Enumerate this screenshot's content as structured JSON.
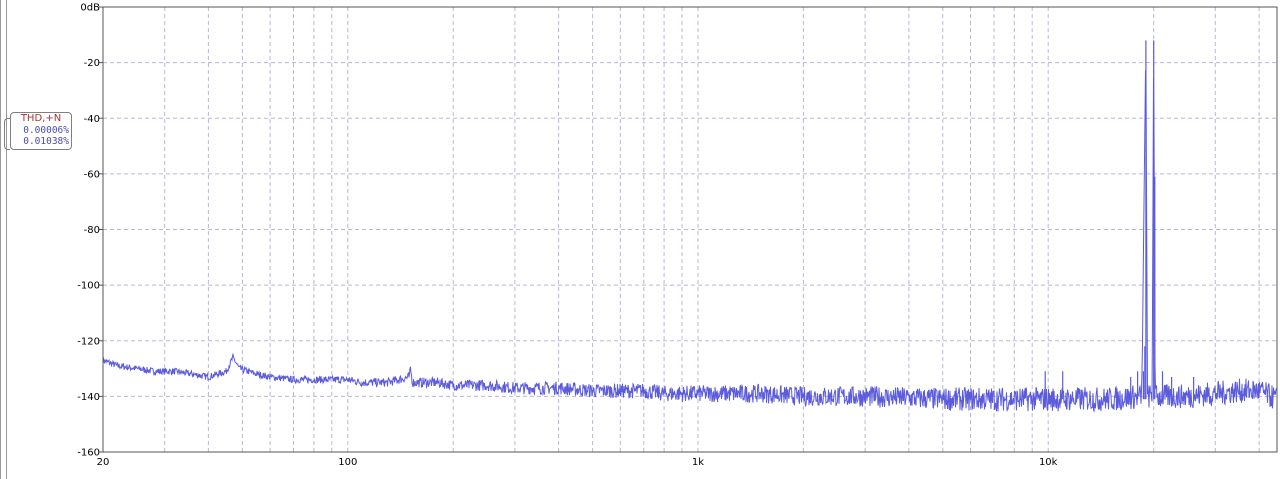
{
  "legend": {
    "title": "THD,+N",
    "values": [
      "0.00006%",
      "0.01038%"
    ]
  },
  "colors": {
    "trace": "#5b5bdc",
    "grid": "#b8b8d8",
    "frame": "#555555",
    "legend_title": "#b03030",
    "legend_value": "#4a4ab8"
  },
  "chart_data": {
    "type": "line",
    "title": "",
    "xlabel": "",
    "ylabel": "",
    "x_scale": "log",
    "xlim": [
      20,
      45000
    ],
    "ylim": [
      -160,
      0
    ],
    "grid": true,
    "x_ticks": [
      {
        "value": 20,
        "label": "20"
      },
      {
        "value": 100,
        "label": "100"
      },
      {
        "value": 1000,
        "label": "1k"
      },
      {
        "value": 10000,
        "label": "10k"
      }
    ],
    "y_ticks": [
      {
        "value": 0,
        "label": "0dB"
      },
      {
        "value": -20,
        "label": "-20"
      },
      {
        "value": -40,
        "label": "-40"
      },
      {
        "value": -60,
        "label": "-60"
      },
      {
        "value": -80,
        "label": "-80"
      },
      {
        "value": -100,
        "label": "-100"
      },
      {
        "value": -120,
        "label": "-120"
      },
      {
        "value": -140,
        "label": "-140"
      },
      {
        "value": -160,
        "label": "-160"
      }
    ],
    "series": [
      {
        "points": [
          [
            20,
            -127
          ],
          [
            22,
            -129
          ],
          [
            25,
            -130
          ],
          [
            28,
            -131
          ],
          [
            32,
            -131
          ],
          [
            36,
            -132
          ],
          [
            40,
            -133
          ],
          [
            45,
            -131
          ],
          [
            47,
            -126
          ],
          [
            49,
            -130
          ],
          [
            55,
            -132
          ],
          [
            60,
            -133
          ],
          [
            70,
            -134
          ],
          [
            80,
            -134
          ],
          [
            90,
            -134
          ],
          [
            100,
            -134
          ],
          [
            110,
            -135
          ],
          [
            130,
            -135
          ],
          [
            150,
            -133
          ],
          [
            151,
            -130
          ],
          [
            153,
            -135
          ],
          [
            180,
            -135
          ],
          [
            200,
            -136
          ],
          [
            250,
            -136
          ],
          [
            300,
            -137
          ],
          [
            350,
            -137
          ],
          [
            400,
            -137
          ],
          [
            500,
            -138
          ],
          [
            600,
            -138
          ],
          [
            700,
            -138
          ],
          [
            800,
            -139
          ],
          [
            1000,
            -139
          ],
          [
            1500,
            -139
          ],
          [
            2000,
            -140
          ],
          [
            3000,
            -140
          ],
          [
            5000,
            -141
          ],
          [
            7000,
            -141
          ],
          [
            10000,
            -141
          ],
          [
            15000,
            -141
          ],
          [
            18500,
            -140
          ],
          [
            19000,
            -12
          ],
          [
            19200,
            -140
          ],
          [
            19800,
            -140
          ],
          [
            20000,
            -12
          ],
          [
            20200,
            -140
          ],
          [
            25000,
            -140
          ],
          [
            30000,
            -139
          ],
          [
            35000,
            -138
          ],
          [
            40000,
            -138
          ],
          [
            45000,
            -141
          ]
        ]
      }
    ],
    "spikes": [
      {
        "x": 9800,
        "y": -131
      },
      {
        "x": 11000,
        "y": -131
      },
      {
        "x": 17200,
        "y": -133
      },
      {
        "x": 18000,
        "y": -131
      },
      {
        "x": 18700,
        "y": -131
      },
      {
        "x": 18870,
        "y": -122
      },
      {
        "x": 19000,
        "y": -12
      },
      {
        "x": 20000,
        "y": -12
      },
      {
        "x": 20150,
        "y": -61
      },
      {
        "x": 21200,
        "y": -131
      },
      {
        "x": 22500,
        "y": -133
      },
      {
        "x": 26000,
        "y": -133
      }
    ]
  }
}
